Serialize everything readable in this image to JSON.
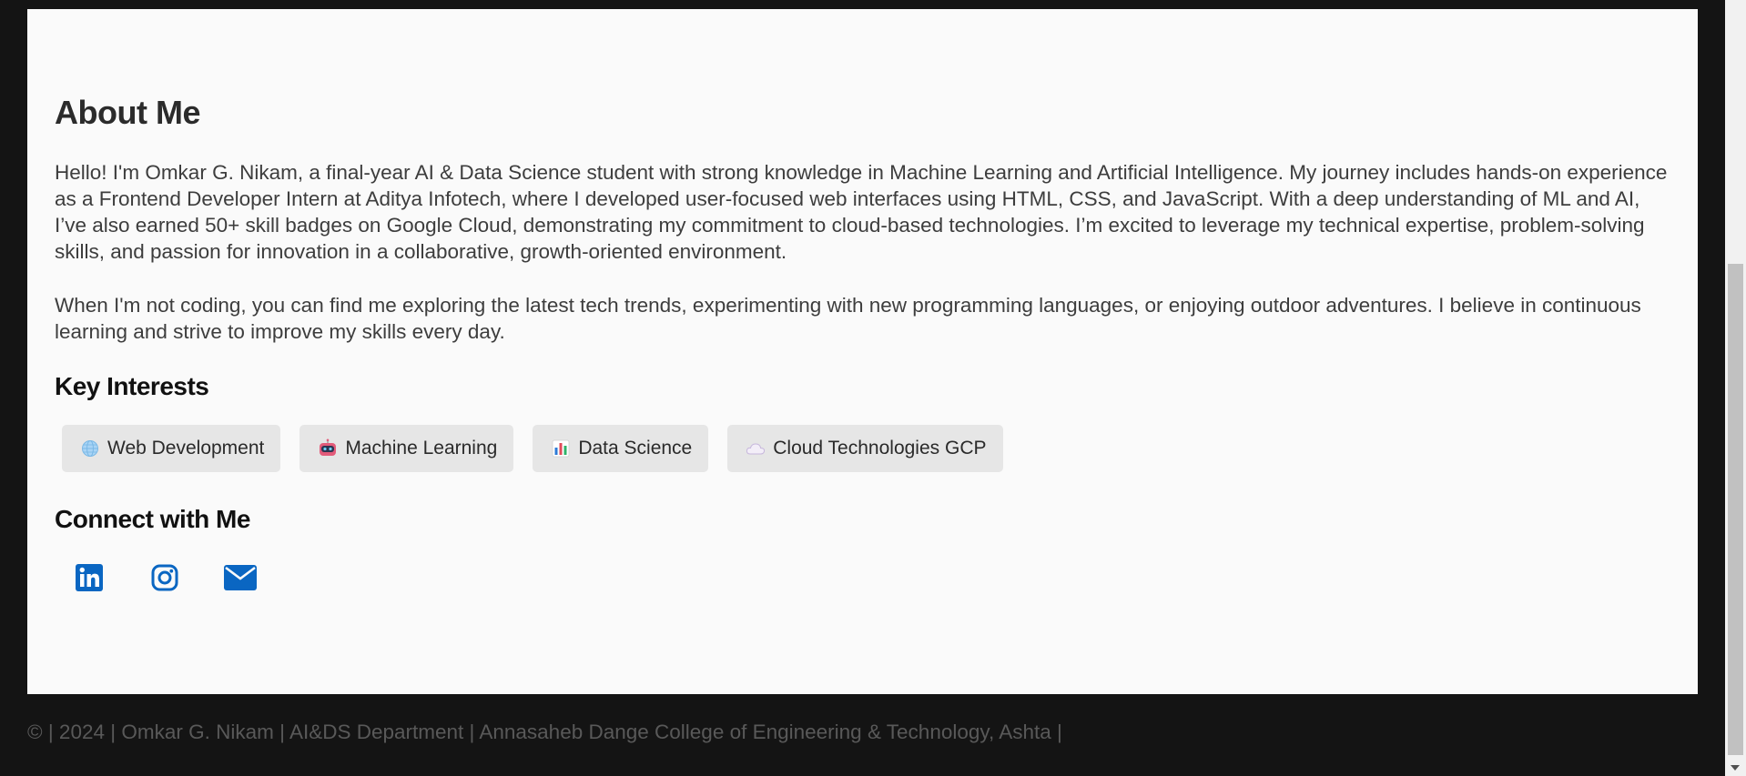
{
  "about": {
    "title": "About Me",
    "paragraph1": "Hello! I'm Omkar G. Nikam, a final-year AI & Data Science student with strong knowledge in Machine Learning and Artificial Intelligence. My journey includes hands-on experience as a Frontend Developer Intern at Aditya Infotech, where I developed user-focused web interfaces using HTML, CSS, and JavaScript. With a deep understanding of ML and AI, I’ve also earned 50+ skill badges on Google Cloud, demonstrating my commitment to cloud-based technologies. I’m excited to leverage my technical expertise, problem-solving skills, and passion for innovation in a collaborative, growth-oriented environment.",
    "paragraph2": "When I'm not coding, you can find me exploring the latest tech trends, experimenting with new programming languages, or enjoying outdoor adventures. I believe in continuous learning and strive to improve my skills every day."
  },
  "interests": {
    "title": "Key Interests",
    "items": [
      {
        "label": "Web Development",
        "icon": "globe-icon"
      },
      {
        "label": "Machine Learning",
        "icon": "robot-icon"
      },
      {
        "label": "Data Science",
        "icon": "bar-chart-icon"
      },
      {
        "label": "Cloud Technologies GCP",
        "icon": "cloud-icon"
      }
    ]
  },
  "connect": {
    "title": "Connect with Me",
    "links": [
      {
        "name": "linkedin",
        "icon": "linkedin-icon"
      },
      {
        "name": "instagram",
        "icon": "instagram-icon"
      },
      {
        "name": "email",
        "icon": "envelope-icon"
      }
    ]
  },
  "footer": {
    "text": "© | 2024 | Omkar G. Nikam | AI&DS Department | Annasaheb Dange College of Engineering & Technology, Ashta |"
  },
  "colors": {
    "page_bg": "#141414",
    "card_bg": "#fafafa",
    "chip_bg": "#e6e6e6",
    "social_blue": "#0a66c2"
  }
}
